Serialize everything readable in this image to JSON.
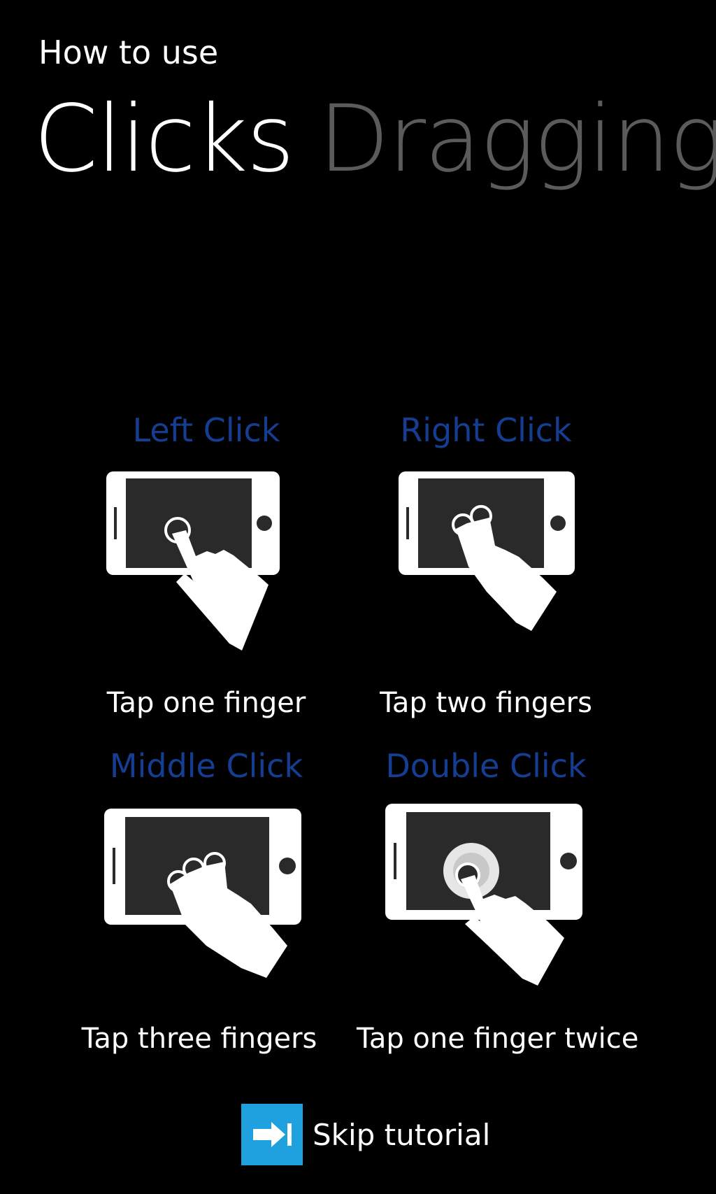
{
  "header": {
    "app_label": "How to use",
    "pivots": [
      "Clicks",
      "Dragging"
    ]
  },
  "gestures": [
    {
      "title": "Left Click",
      "description": "Tap one finger",
      "icon": "one-finger-tap-icon"
    },
    {
      "title": "Right Click",
      "description": "Tap two fingers",
      "icon": "two-finger-tap-icon"
    },
    {
      "title": "Middle Click",
      "description": "Tap three fingers",
      "icon": "three-finger-tap-icon"
    },
    {
      "title": "Double Click",
      "description": "Tap one finger twice",
      "icon": "double-tap-icon"
    }
  ],
  "skip": {
    "label": "Skip tutorial",
    "icon": "arrow-right-icon"
  },
  "colors": {
    "background": "#000000",
    "accent_title": "#153e93",
    "inactive_pivot": "#5b5b5b",
    "skip_button": "#1ea1de"
  }
}
